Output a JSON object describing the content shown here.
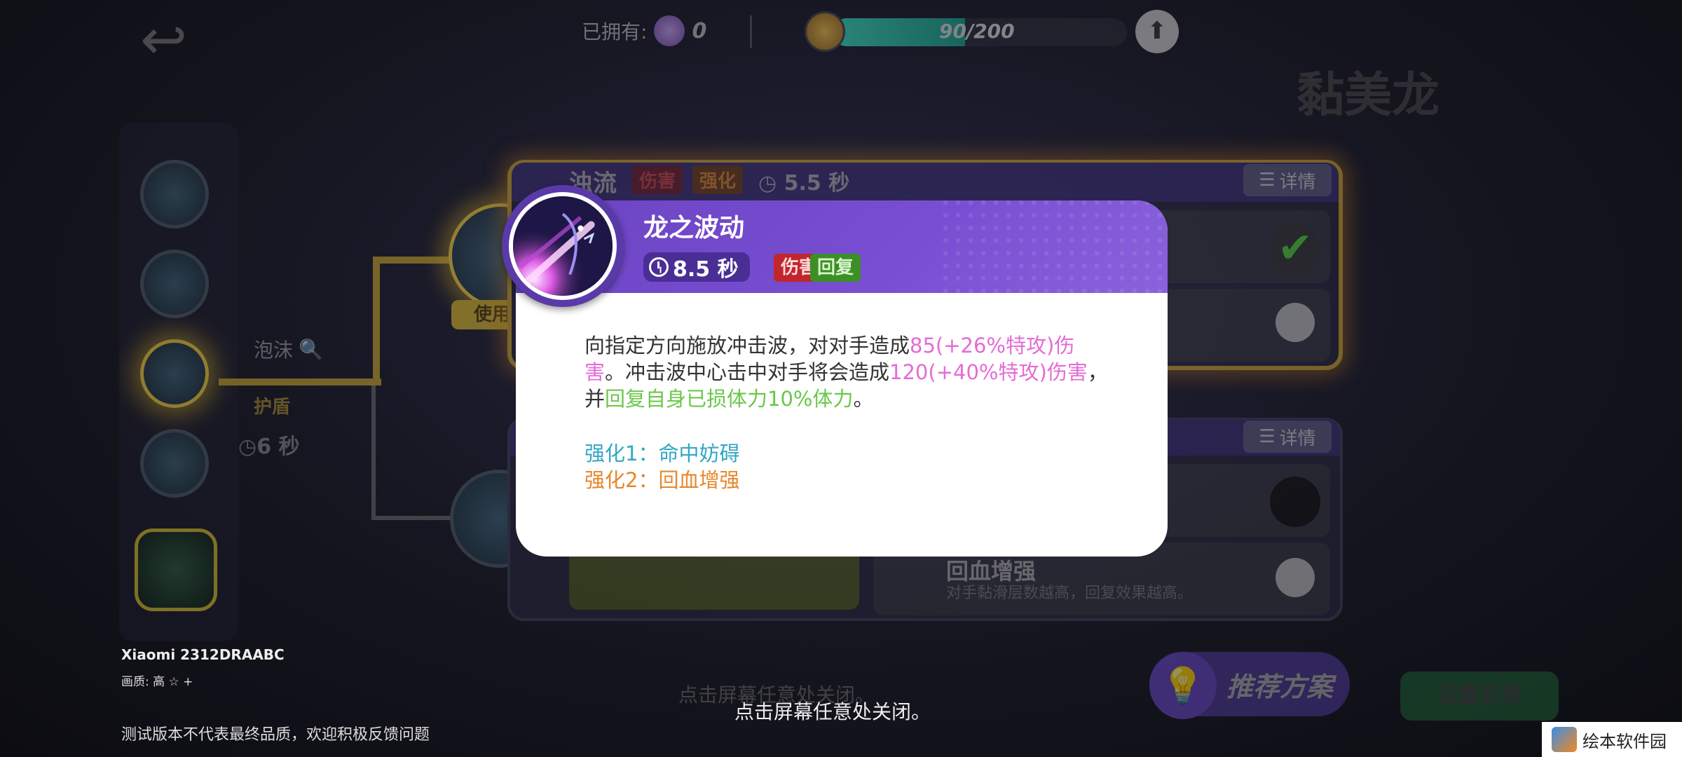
{
  "header": {
    "owned_label": "已拥有:",
    "owned_count": "0",
    "xp_text": "90/200",
    "xp_progress": 0.45,
    "pokemon_name": "黏美龙"
  },
  "left_panel": {
    "label": "",
    "skills": [
      "gear",
      "plant",
      "bubble",
      "shadow",
      "ultimate"
    ]
  },
  "skill_path": {
    "bubble_label": "泡沫",
    "shield_label": "护盾",
    "time_label": "6 秒",
    "use_label": "使用"
  },
  "background_card": {
    "title": "浊流",
    "tag_damage": "伤害",
    "tag_enhance": "强化",
    "cooldown": "5.5 秒",
    "detail_label": "详情"
  },
  "background_card2": {
    "detail_label": "详情",
    "heal_title": "回血增强",
    "heal_desc": "对手黏滑层数越高，回复效果越高。"
  },
  "modal": {
    "skill_name": "龙之波动",
    "cooldown": "8.5 秒",
    "tag_damage": "伤害",
    "tag_heal": "回复",
    "desc_1": "向指定方向施放冲击波，对对手造成",
    "desc_2": "85(+26%特攻)伤害",
    "desc_3": "。冲击波中心击中对手将会造成",
    "desc_4": "120(+40%特攻)伤害",
    "desc_5": "，并",
    "desc_6": "回复自身已损体力10%体力",
    "desc_7": "。",
    "enhance_1": "强化1：命中妨碍",
    "enhance_2": "强化2：回血增强"
  },
  "footer": {
    "device": "Xiaomi 2312DRAABC",
    "quality": "画质: 高 ☆ +",
    "disclaimer": "测试版本不代表最终品质，欢迎积极反馈问题",
    "close_hint_dim": "点击屏幕任意处关闭。",
    "close_hint": "点击屏幕任意处关闭。",
    "recommend_label": "推荐方案",
    "save_label": "设置名称"
  },
  "watermark": {
    "text": "绘本软件园"
  },
  "colors": {
    "modal_header": "#6a44c2",
    "damage_tag": "#c1262c",
    "heal_tag": "#3b8f24",
    "pink_value": "#e56bd6",
    "green_value": "#6ac84a",
    "enhance_1": "#33a7c4",
    "enhance_2": "#e8862c"
  }
}
